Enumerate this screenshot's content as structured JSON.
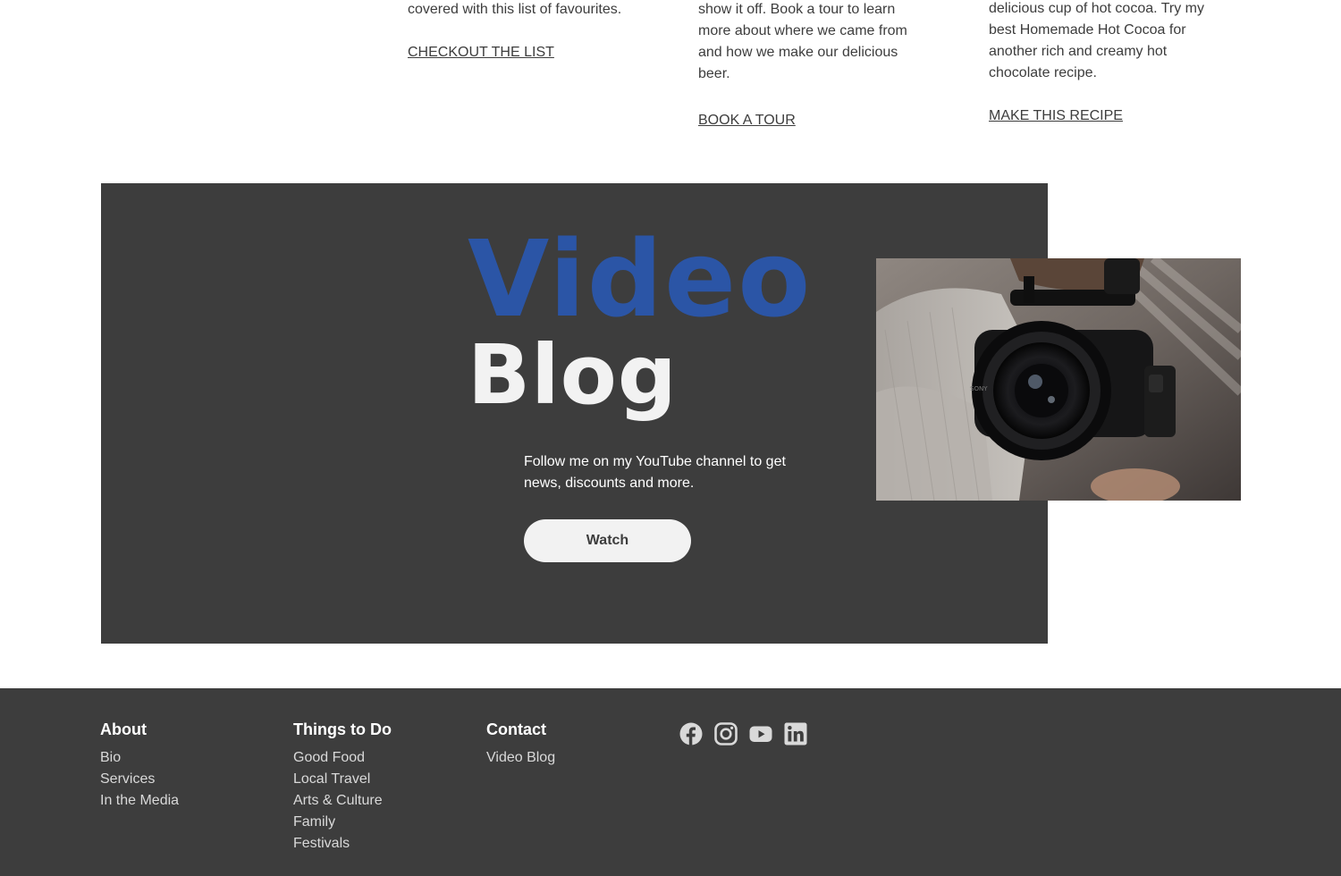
{
  "cards": [
    {
      "text": "covered with this list of favourites.",
      "link": "CHECKOUT THE LIST"
    },
    {
      "text": "show it off. Book a tour to learn more about where we came from and how we make our delicious beer.",
      "link": "BOOK A TOUR"
    },
    {
      "text": "delicious cup of hot cocoa. Try my best Homemade Hot Cocoa for another rich and creamy hot chocolate recipe.",
      "link": "MAKE THIS RECIPE"
    }
  ],
  "video": {
    "title_line1": "Video",
    "title_line2": "Blog",
    "description": "Follow me on my YouTube channel to get news, discounts and more.",
    "button_label": "Watch"
  },
  "footer": {
    "about": {
      "heading": "About",
      "links": [
        "Bio",
        "Services",
        "In the Media"
      ]
    },
    "things": {
      "heading": "Things to Do",
      "links": [
        "Good Food",
        "Local Travel",
        "Arts & Culture",
        "Family",
        "Festivals"
      ]
    },
    "contact": {
      "heading": "Contact",
      "links": [
        "Video Blog"
      ]
    },
    "social_icons": [
      "facebook-icon",
      "instagram-icon",
      "youtube-icon",
      "linkedin-icon"
    ]
  },
  "colors": {
    "accent_blue": "#2b55a6",
    "dark_panel": "#3d3d3d",
    "light_button": "#f2f2f2"
  }
}
